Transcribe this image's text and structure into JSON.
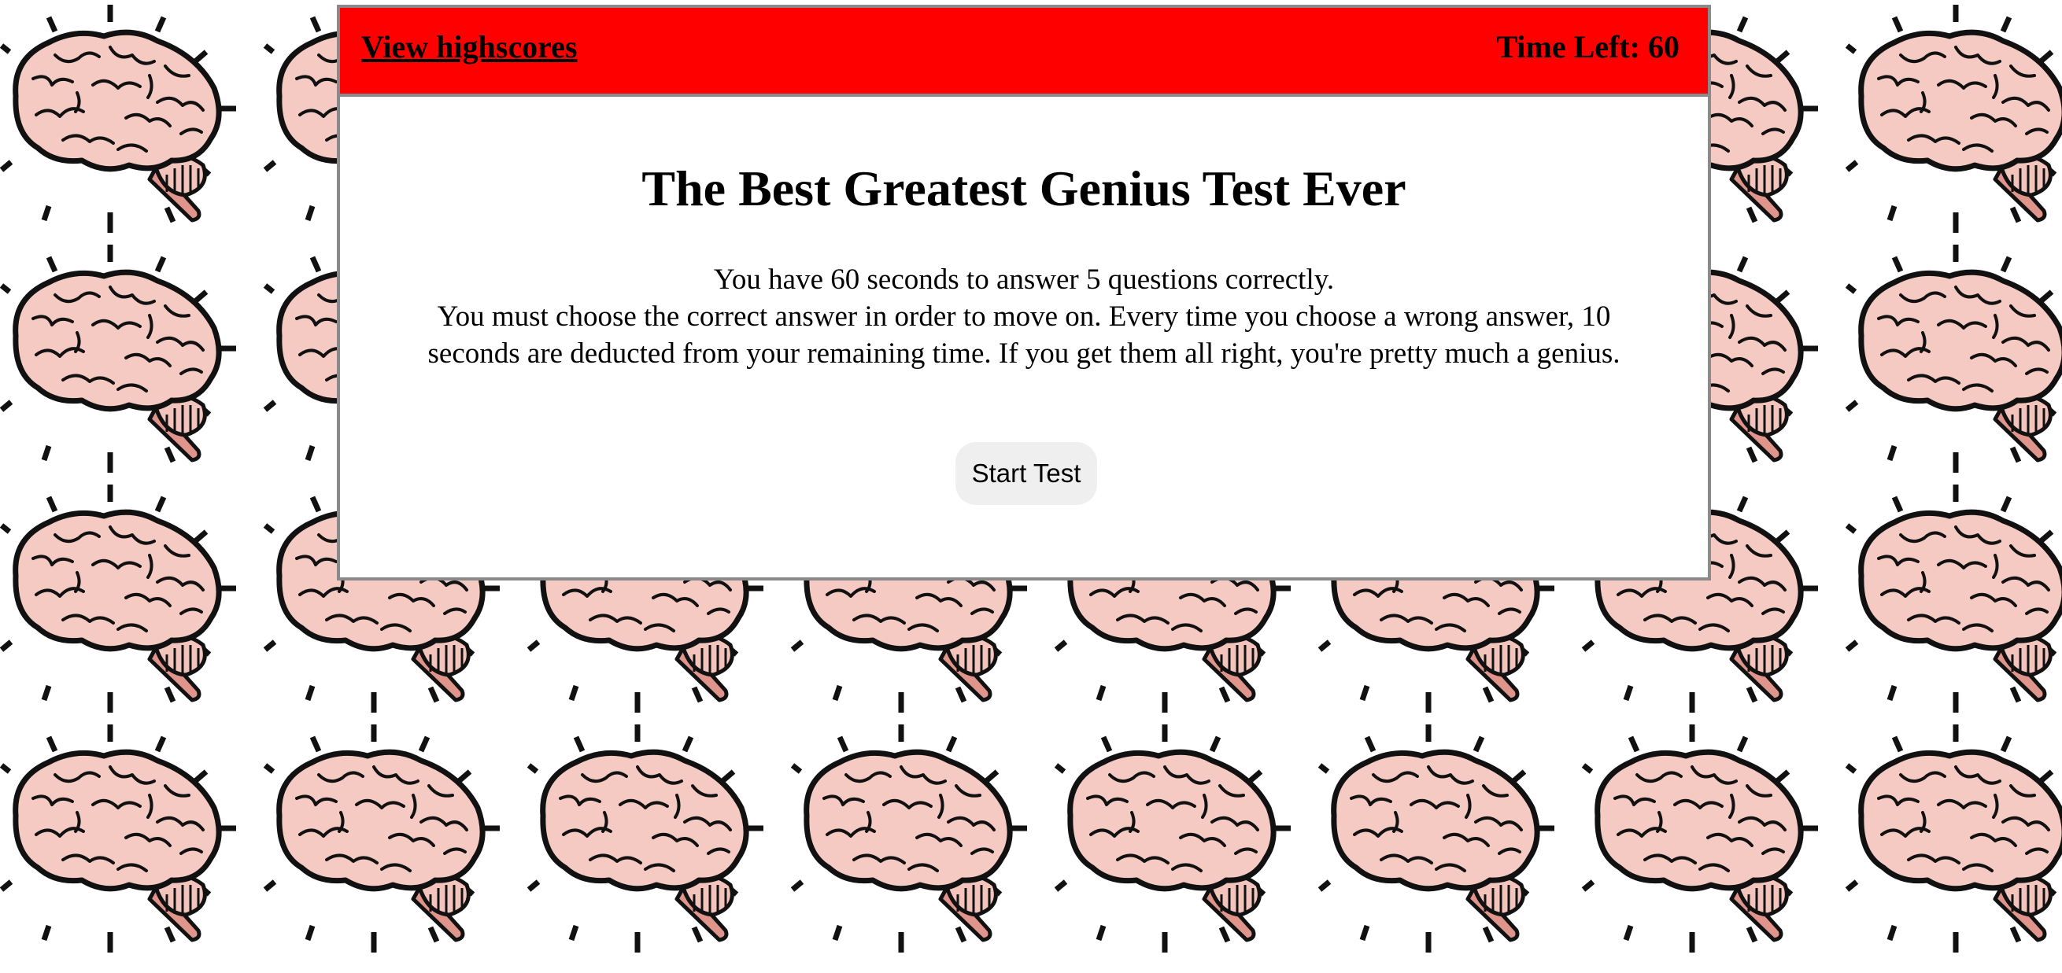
{
  "header": {
    "highscores_link": "View highscores",
    "timer_label": "Time Left:",
    "timer_value": "60"
  },
  "main": {
    "title": "The Best Greatest Genius Test Ever",
    "instructions": [
      "You have 60 seconds to answer 5 questions correctly.",
      "You must choose the correct answer in order to move on. Every time you choose a wrong answer, 10",
      "seconds are deducted from your remaining time. If you get them all right, you're pretty much a genius."
    ],
    "start_button": "Start Test"
  },
  "colors": {
    "header_red": "#ff0000",
    "card_border": "#8a8a8a",
    "brain_pink": "#f5cac2",
    "brain_shadow": "#e8a49a",
    "brainstem_pink": "#e0958c"
  },
  "background": {
    "pattern_icon": "brain-icon"
  }
}
